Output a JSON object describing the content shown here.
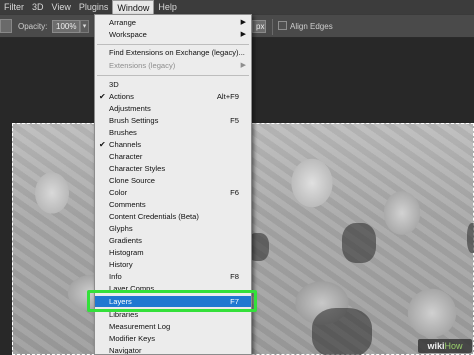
{
  "menubar": {
    "items": [
      {
        "label": "Filter"
      },
      {
        "label": "3D"
      },
      {
        "label": "View"
      },
      {
        "label": "Plugins"
      },
      {
        "label": "Window",
        "active": true
      },
      {
        "label": "Help"
      }
    ]
  },
  "optionsbar": {
    "opacity_label": "Opacity:",
    "opacity_value": "100%",
    "flow_value": "px",
    "align_edges_label": "Align Edges"
  },
  "window_menu": {
    "items": [
      {
        "label": "Arrange",
        "submenu": true
      },
      {
        "label": "Workspace",
        "submenu": true
      },
      {
        "separator": true
      },
      {
        "label": "Find Extensions on Exchange (legacy)..."
      },
      {
        "label": "Extensions (legacy)",
        "submenu": true,
        "disabled": true
      },
      {
        "separator": true
      },
      {
        "label": "3D"
      },
      {
        "label": "Actions",
        "shortcut": "Alt+F9",
        "checked": true
      },
      {
        "label": "Adjustments"
      },
      {
        "label": "Brush Settings",
        "shortcut": "F5"
      },
      {
        "label": "Brushes"
      },
      {
        "label": "Channels",
        "checked": true
      },
      {
        "label": "Character"
      },
      {
        "label": "Character Styles"
      },
      {
        "label": "Clone Source"
      },
      {
        "label": "Color",
        "shortcut": "F6"
      },
      {
        "label": "Comments"
      },
      {
        "label": "Content Credentials (Beta)"
      },
      {
        "label": "Glyphs"
      },
      {
        "label": "Gradients"
      },
      {
        "label": "Histogram"
      },
      {
        "label": "History"
      },
      {
        "label": "Info",
        "shortcut": "F8"
      },
      {
        "label": "Layer Comps"
      },
      {
        "label": "Layers",
        "shortcut": "F7",
        "highlighted": true
      },
      {
        "label": "Libraries"
      },
      {
        "label": "Measurement Log"
      },
      {
        "label": "Modifier Keys"
      },
      {
        "label": "Navigator"
      }
    ]
  },
  "watermark": {
    "wiki": "wiki",
    "how": "How"
  },
  "colors": {
    "menu_bg": "#ececec",
    "highlight": "#1f78d1",
    "green_box": "#33e03a",
    "app_bg": "#282828"
  }
}
